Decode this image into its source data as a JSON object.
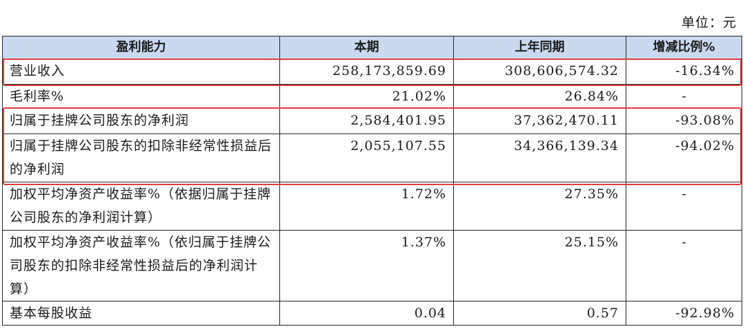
{
  "unit_label": "单位：元",
  "table": {
    "headers": [
      "盈利能力",
      "本期",
      "上年同期",
      "增减比例%"
    ],
    "rows": [
      {
        "label": "营业收入",
        "current": "258,173,859.69",
        "previous": "308,606,574.32",
        "change": "-16.34%"
      },
      {
        "label": "毛利率%",
        "current": "21.02%",
        "previous": "26.84%",
        "change": "-"
      },
      {
        "label": "归属于挂牌公司股东的净利润",
        "current": "2,584,401.95",
        "previous": "37,362,470.11",
        "change": "-93.08%"
      },
      {
        "label": "归属于挂牌公司股东的扣除非经常性损益后的净利润",
        "current": "2,055,107.55",
        "previous": "34,366,139.34",
        "change": "-94.02%"
      },
      {
        "label": "加权平均净资产收益率%（依据归属于挂牌公司股东的净利润计算）",
        "current": "1.72%",
        "previous": "27.35%",
        "change": "-"
      },
      {
        "label": "加权平均净资产收益率%（依归属于挂牌公司股东的扣除非经常性损益后的净利润计算）",
        "current": "1.37%",
        "previous": "25.15%",
        "change": "-"
      },
      {
        "label": "基本每股收益",
        "current": "0.04",
        "previous": "0.57",
        "change": "-92.98%"
      }
    ]
  },
  "colors": {
    "header_bg": "#c9daf0",
    "highlight": "#e23a3a",
    "border": "#222222"
  }
}
